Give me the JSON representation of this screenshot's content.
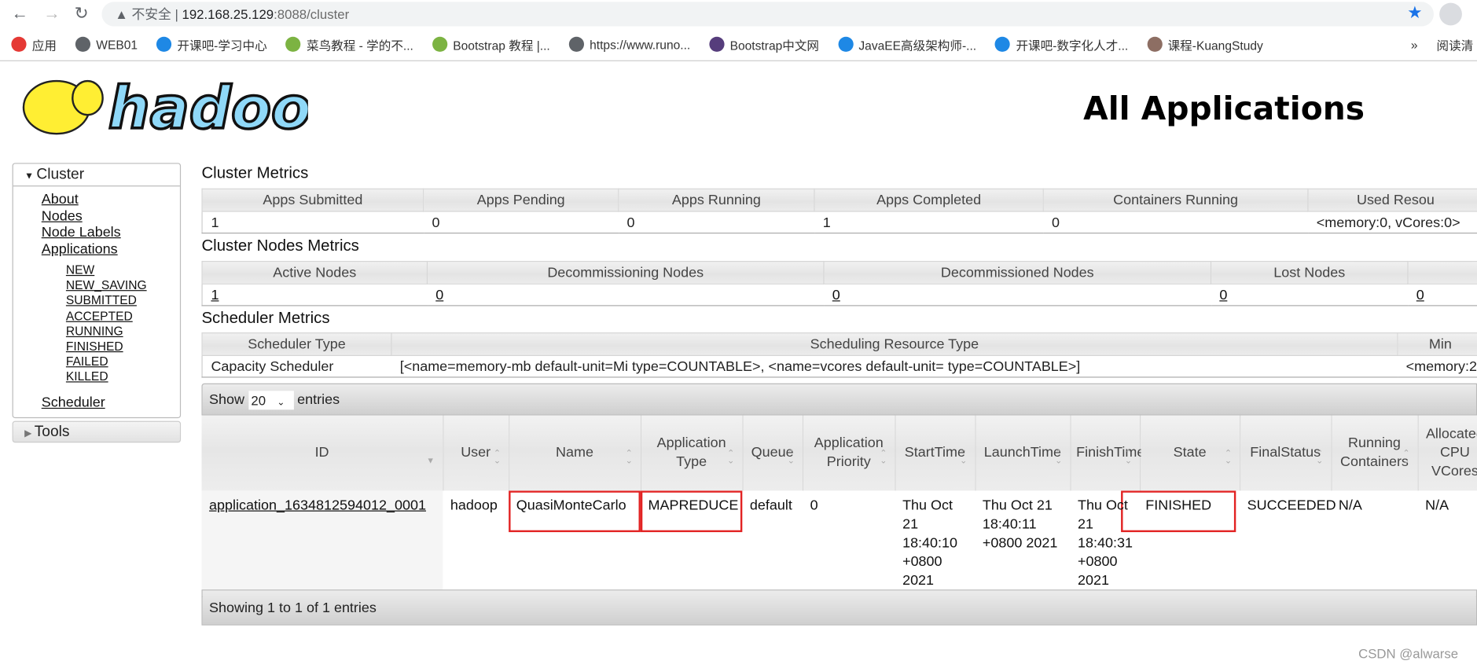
{
  "browser": {
    "back_icon": "arrow-left-icon",
    "forward_icon": "arrow-right-icon",
    "reload_icon": "reload-icon",
    "security": "不安全",
    "url_host": "192.168.25.129",
    "url_rest": ":8088/cluster",
    "bookmarks": [
      {
        "label": "应用",
        "color": "#e53935"
      },
      {
        "label": "WEB01",
        "color": "#5f6368"
      },
      {
        "label": "开课吧-学习中心",
        "color": "#1e88e5"
      },
      {
        "label": "菜鸟教程 - 学的不...",
        "color": "#7cb342"
      },
      {
        "label": "Bootstrap 教程 |...",
        "color": "#7cb342"
      },
      {
        "label": "https://www.runo...",
        "color": "#5f6368"
      },
      {
        "label": "Bootstrap中文网",
        "color": "#563d7c"
      },
      {
        "label": "JavaEE高级架构师-...",
        "color": "#1e88e5"
      },
      {
        "label": "开课吧-数字化人才...",
        "color": "#1e88e5"
      },
      {
        "label": "课程-KuangStudy",
        "color": "#8d6e63"
      }
    ],
    "more": "»",
    "reading": "阅读清"
  },
  "logo": "hadoop",
  "page_title": "All Applications",
  "sidebar": {
    "cluster": "Cluster",
    "items": [
      "About",
      "Nodes",
      "Node Labels",
      "Applications"
    ],
    "states": [
      "NEW",
      "NEW_SAVING",
      "SUBMITTED",
      "ACCEPTED",
      "RUNNING",
      "FINISHED",
      "FAILED",
      "KILLED"
    ],
    "scheduler": "Scheduler",
    "tools": "Tools"
  },
  "cluster_metrics": {
    "title": "Cluster Metrics",
    "headers": [
      "Apps Submitted",
      "Apps Pending",
      "Apps Running",
      "Apps Completed",
      "Containers Running",
      "Used Resou"
    ],
    "values": [
      "1",
      "0",
      "0",
      "1",
      "0",
      "<memory:0, vCores:0>"
    ]
  },
  "nodes_metrics": {
    "title": "Cluster Nodes Metrics",
    "headers": [
      "Active Nodes",
      "Decommissioning Nodes",
      "Decommissioned Nodes",
      "Lost Nodes",
      ""
    ],
    "values": [
      "1",
      "0",
      "0",
      "0",
      "0"
    ]
  },
  "scheduler_metrics": {
    "title": "Scheduler Metrics",
    "headers": [
      "Scheduler Type",
      "Scheduling Resource Type",
      "Min"
    ],
    "values": [
      "Capacity Scheduler",
      "[<name=memory-mb default-unit=Mi type=COUNTABLE>, <name=vcores default-unit= type=COUNTABLE>]",
      "<memory:2"
    ]
  },
  "apps": {
    "show": "Show",
    "page_size": "20",
    "entries": "entries",
    "headers": [
      "ID",
      "User",
      "Name",
      "Application Type",
      "Queue",
      "Application Priority",
      "StartTime",
      "LaunchTime",
      "FinishTime",
      "State",
      "FinalStatus",
      "Running Containers",
      "Allocated CPU VCores"
    ],
    "rows": [
      [
        "application_1634812594012_0001",
        "hadoop",
        "QuasiMonteCarlo",
        "MAPREDUCE",
        "default",
        "0",
        "Thu Oct 21 18:40:10 +0800 2021",
        "Thu Oct 21 18:40:11 +0800 2021",
        "Thu Oct 21 18:40:31 +0800 2021",
        "FINISHED",
        "SUCCEEDED",
        "N/A",
        "N/A"
      ]
    ],
    "footer": "Showing 1 to 1 of 1 entries",
    "highlight_color": "#e22222"
  },
  "watermark": "CSDN @alwarse"
}
